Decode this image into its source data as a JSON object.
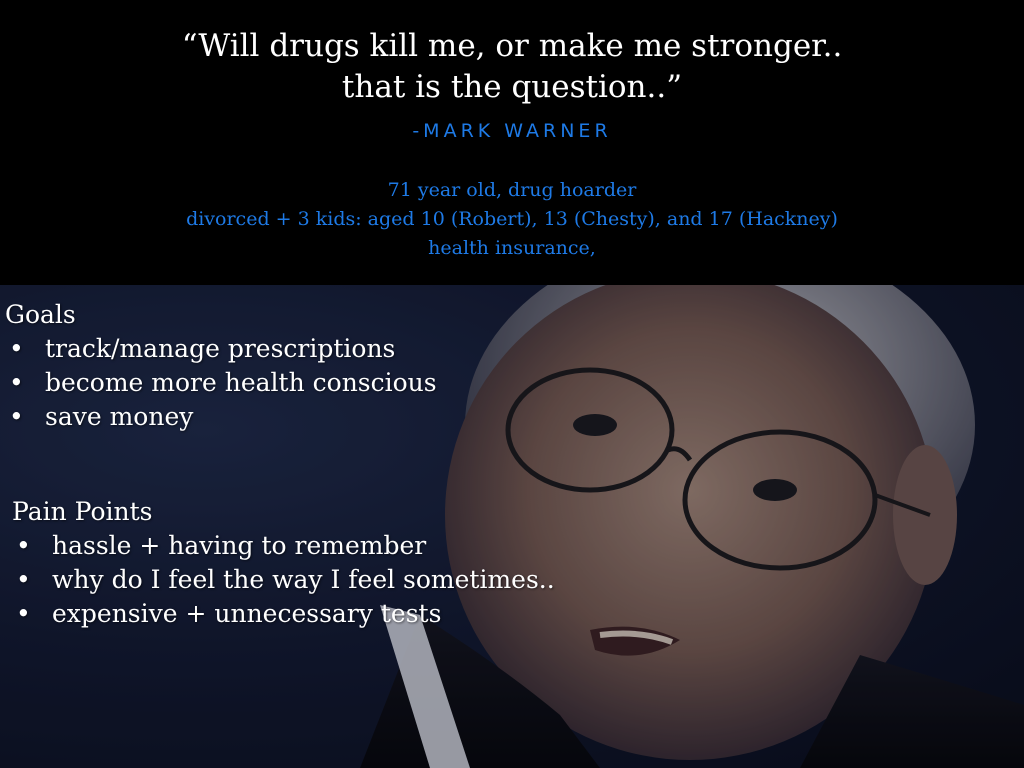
{
  "header": {
    "quote_line1": "“Will drugs kill me, or make me stronger..",
    "quote_line2": "that is the question..”",
    "attribution": "-MARK WARNER",
    "bio_line1": "71 year old, drug hoarder",
    "bio_line2": "divorced + 3 kids: aged 10 (Robert), 13 (Chesty), and 17 (Hackney)",
    "bio_line3": "health insurance,"
  },
  "goals": {
    "heading": "Goals",
    "items": [
      "track/manage prescriptions",
      "become more health conscious",
      "save money"
    ]
  },
  "pain_points": {
    "heading": "Pain Points",
    "items": [
      "hassle + having to remember",
      "why do I feel the way I feel sometimes..",
      "expensive + unnecessary tests"
    ]
  },
  "bullet_glyph": "•",
  "colors": {
    "background": "#000000",
    "quote_text": "#ffffff",
    "accent_blue": "#1e7ae6",
    "photo_backdrop": "#131a33"
  }
}
